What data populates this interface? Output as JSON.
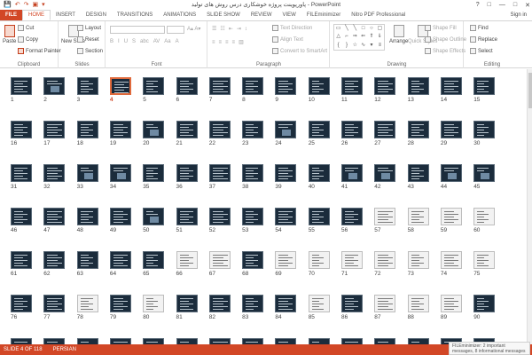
{
  "window": {
    "title": "پاورپوینت پروژه خوشکاری درس روش های تولید - PowerPoint",
    "signin": "Sign in",
    "controls": [
      "?",
      "□",
      "—",
      "□",
      "✕"
    ]
  },
  "qat": [
    "💾",
    "↶",
    "↷",
    "▣",
    "▾"
  ],
  "tabs": [
    "FILE",
    "HOME",
    "INSERT",
    "DESIGN",
    "TRANSITIONS",
    "ANIMATIONS",
    "SLIDE SHOW",
    "REVIEW",
    "VIEW",
    "FILEminimizer",
    "Nitro PDF Professional"
  ],
  "active_tab": "HOME",
  "ribbon": {
    "clipboard": {
      "label": "Clipboard",
      "paste": "Paste",
      "cut": "Cut",
      "copy": "Copy",
      "format_painter": "Format Painter"
    },
    "slides": {
      "label": "Slides",
      "new_slide": "New Slide",
      "layout": "Layout",
      "reset": "Reset",
      "section": "Section"
    },
    "font": {
      "label": "Font"
    },
    "paragraph": {
      "label": "Paragraph",
      "text_direction": "Text Direction",
      "align_text": "Align Text",
      "convert": "Convert to SmartArt"
    },
    "drawing": {
      "label": "Drawing",
      "arrange": "Arrange",
      "quick_styles": "Quick Styles",
      "shape_fill": "Shape Fill",
      "shape_outline": "Shape Outline",
      "shape_effects": "Shape Effects"
    },
    "editing": {
      "label": "Editing",
      "find": "Find",
      "replace": "Replace",
      "select": "Select"
    }
  },
  "slides": {
    "total": 118,
    "selected": 4,
    "image_slides": [
      2,
      20,
      24,
      33,
      34,
      41,
      42,
      44,
      45,
      50
    ],
    "light_slides": [
      57,
      58,
      59,
      60,
      66,
      67,
      69,
      70,
      71,
      72,
      73,
      74,
      75,
      78,
      80,
      85,
      87,
      88,
      89
    ]
  },
  "status": {
    "slide_info": "SLIDE 4 OF 118",
    "language": "PERSIAN",
    "notification": "FILEminimizer: 2 important messages, 8 informational messages"
  }
}
